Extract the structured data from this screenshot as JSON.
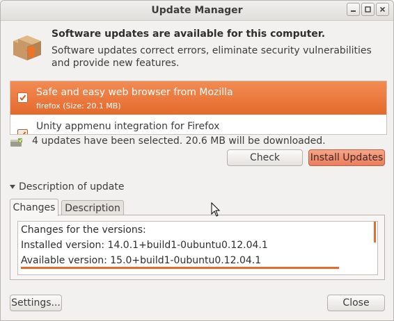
{
  "window": {
    "title": "Update Manager"
  },
  "header": {
    "title": "Software updates are available for this computer.",
    "description": "Software updates correct errors, eliminate security vulnerabilities and provide new features."
  },
  "updates": [
    {
      "name": "Safe and easy web browser from Mozilla",
      "detail": "firefox (Size: 20.1 MB)",
      "checked": true,
      "selected": true
    },
    {
      "name": "Unity appmenu integration for Firefox",
      "detail": "",
      "checked": true,
      "selected": false
    }
  ],
  "status": {
    "text": "4 updates have been selected. 20.6 MB will be downloaded."
  },
  "buttons": {
    "check": "Check",
    "install": "Install Updates",
    "settings": "Settings...",
    "close": "Close"
  },
  "description_expander": {
    "label": "Description of update",
    "expanded": true
  },
  "tabs": [
    {
      "label": "Changes",
      "active": true
    },
    {
      "label": "Description",
      "active": false
    }
  ],
  "changes": {
    "heading": "Changes for the versions:",
    "installed": "Installed version: 14.0.1+build1-0ubuntu0.12.04.1",
    "available": "Available version: 15.0+build1-0ubuntu0.12.04.1"
  },
  "colors": {
    "accent": "#e56a2c",
    "primary_button": "#ec7d5c",
    "window_bg": "#f2f1f0"
  },
  "icons": [
    "package-icon",
    "download-status-icon",
    "checkbox-checked-icon",
    "mouse-pointer-icon"
  ]
}
